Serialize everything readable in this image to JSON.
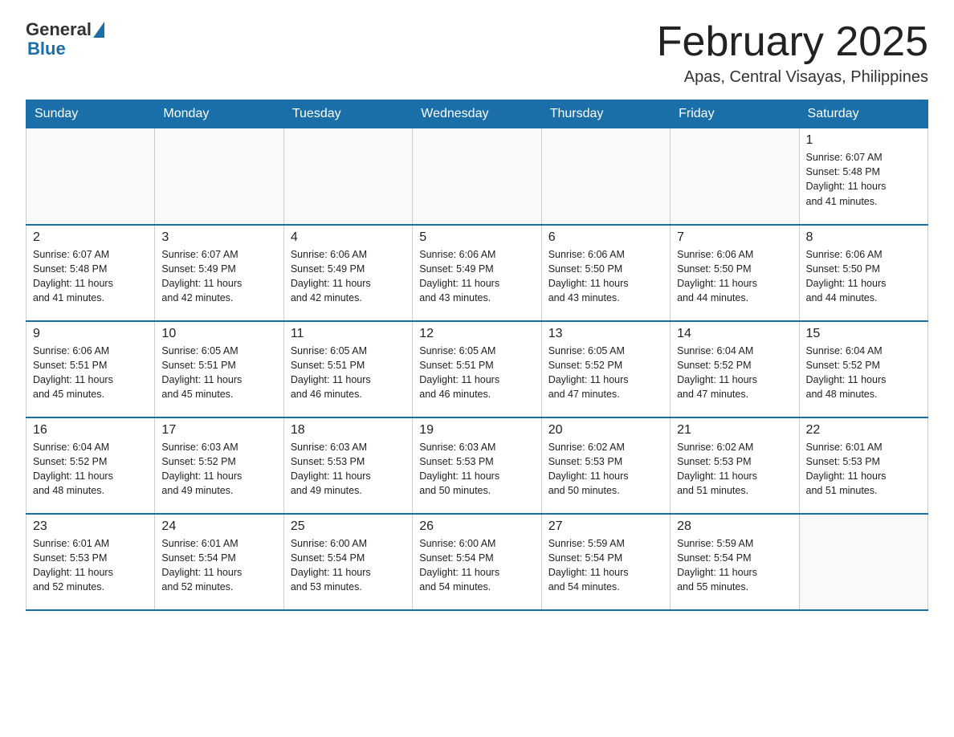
{
  "logo": {
    "general": "General",
    "blue": "Blue"
  },
  "title": "February 2025",
  "subtitle": "Apas, Central Visayas, Philippines",
  "header_days": [
    "Sunday",
    "Monday",
    "Tuesday",
    "Wednesday",
    "Thursday",
    "Friday",
    "Saturday"
  ],
  "weeks": [
    [
      {
        "day": "",
        "info": ""
      },
      {
        "day": "",
        "info": ""
      },
      {
        "day": "",
        "info": ""
      },
      {
        "day": "",
        "info": ""
      },
      {
        "day": "",
        "info": ""
      },
      {
        "day": "",
        "info": ""
      },
      {
        "day": "1",
        "info": "Sunrise: 6:07 AM\nSunset: 5:48 PM\nDaylight: 11 hours\nand 41 minutes."
      }
    ],
    [
      {
        "day": "2",
        "info": "Sunrise: 6:07 AM\nSunset: 5:48 PM\nDaylight: 11 hours\nand 41 minutes."
      },
      {
        "day": "3",
        "info": "Sunrise: 6:07 AM\nSunset: 5:49 PM\nDaylight: 11 hours\nand 42 minutes."
      },
      {
        "day": "4",
        "info": "Sunrise: 6:06 AM\nSunset: 5:49 PM\nDaylight: 11 hours\nand 42 minutes."
      },
      {
        "day": "5",
        "info": "Sunrise: 6:06 AM\nSunset: 5:49 PM\nDaylight: 11 hours\nand 43 minutes."
      },
      {
        "day": "6",
        "info": "Sunrise: 6:06 AM\nSunset: 5:50 PM\nDaylight: 11 hours\nand 43 minutes."
      },
      {
        "day": "7",
        "info": "Sunrise: 6:06 AM\nSunset: 5:50 PM\nDaylight: 11 hours\nand 44 minutes."
      },
      {
        "day": "8",
        "info": "Sunrise: 6:06 AM\nSunset: 5:50 PM\nDaylight: 11 hours\nand 44 minutes."
      }
    ],
    [
      {
        "day": "9",
        "info": "Sunrise: 6:06 AM\nSunset: 5:51 PM\nDaylight: 11 hours\nand 45 minutes."
      },
      {
        "day": "10",
        "info": "Sunrise: 6:05 AM\nSunset: 5:51 PM\nDaylight: 11 hours\nand 45 minutes."
      },
      {
        "day": "11",
        "info": "Sunrise: 6:05 AM\nSunset: 5:51 PM\nDaylight: 11 hours\nand 46 minutes."
      },
      {
        "day": "12",
        "info": "Sunrise: 6:05 AM\nSunset: 5:51 PM\nDaylight: 11 hours\nand 46 minutes."
      },
      {
        "day": "13",
        "info": "Sunrise: 6:05 AM\nSunset: 5:52 PM\nDaylight: 11 hours\nand 47 minutes."
      },
      {
        "day": "14",
        "info": "Sunrise: 6:04 AM\nSunset: 5:52 PM\nDaylight: 11 hours\nand 47 minutes."
      },
      {
        "day": "15",
        "info": "Sunrise: 6:04 AM\nSunset: 5:52 PM\nDaylight: 11 hours\nand 48 minutes."
      }
    ],
    [
      {
        "day": "16",
        "info": "Sunrise: 6:04 AM\nSunset: 5:52 PM\nDaylight: 11 hours\nand 48 minutes."
      },
      {
        "day": "17",
        "info": "Sunrise: 6:03 AM\nSunset: 5:52 PM\nDaylight: 11 hours\nand 49 minutes."
      },
      {
        "day": "18",
        "info": "Sunrise: 6:03 AM\nSunset: 5:53 PM\nDaylight: 11 hours\nand 49 minutes."
      },
      {
        "day": "19",
        "info": "Sunrise: 6:03 AM\nSunset: 5:53 PM\nDaylight: 11 hours\nand 50 minutes."
      },
      {
        "day": "20",
        "info": "Sunrise: 6:02 AM\nSunset: 5:53 PM\nDaylight: 11 hours\nand 50 minutes."
      },
      {
        "day": "21",
        "info": "Sunrise: 6:02 AM\nSunset: 5:53 PM\nDaylight: 11 hours\nand 51 minutes."
      },
      {
        "day": "22",
        "info": "Sunrise: 6:01 AM\nSunset: 5:53 PM\nDaylight: 11 hours\nand 51 minutes."
      }
    ],
    [
      {
        "day": "23",
        "info": "Sunrise: 6:01 AM\nSunset: 5:53 PM\nDaylight: 11 hours\nand 52 minutes."
      },
      {
        "day": "24",
        "info": "Sunrise: 6:01 AM\nSunset: 5:54 PM\nDaylight: 11 hours\nand 52 minutes."
      },
      {
        "day": "25",
        "info": "Sunrise: 6:00 AM\nSunset: 5:54 PM\nDaylight: 11 hours\nand 53 minutes."
      },
      {
        "day": "26",
        "info": "Sunrise: 6:00 AM\nSunset: 5:54 PM\nDaylight: 11 hours\nand 54 minutes."
      },
      {
        "day": "27",
        "info": "Sunrise: 5:59 AM\nSunset: 5:54 PM\nDaylight: 11 hours\nand 54 minutes."
      },
      {
        "day": "28",
        "info": "Sunrise: 5:59 AM\nSunset: 5:54 PM\nDaylight: 11 hours\nand 55 minutes."
      },
      {
        "day": "",
        "info": ""
      }
    ]
  ]
}
